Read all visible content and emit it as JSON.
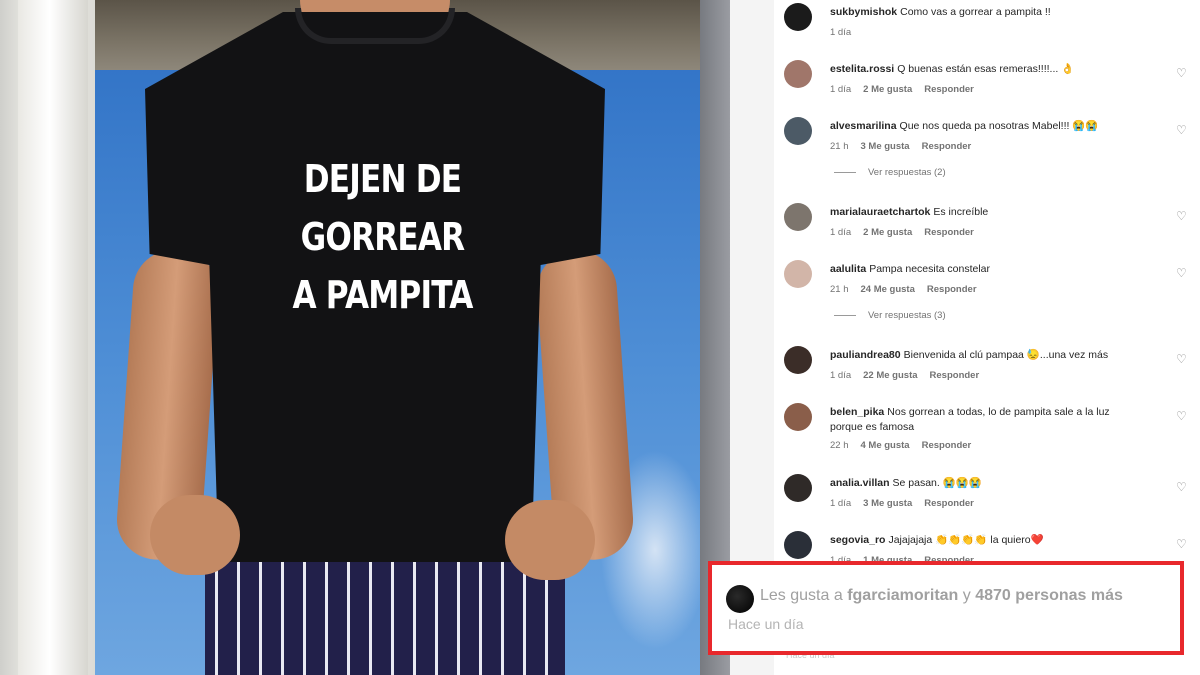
{
  "photo": {
    "shirt_lines": [
      "DEJEN DE",
      "GORREAR",
      "A PAMPITA"
    ]
  },
  "comments": [
    {
      "user": "sukbymishok",
      "text": "Como vas a gorrear a pampita !!",
      "time": "1 día",
      "likes": "",
      "reply": "",
      "avatar_color": "#1b1b1b",
      "heart": false
    },
    {
      "user": "estelita.rossi",
      "text": "Q buenas están esas remeras!!!!... 👌",
      "time": "1 día",
      "likes": "2 Me gusta",
      "reply": "Responder",
      "avatar_color": "#a0766a",
      "heart": true
    },
    {
      "user": "alvesmarilina",
      "text": "Que nos queda pa nosotras Mabel!!! 😭😭",
      "time": "21 h",
      "likes": "3 Me gusta",
      "reply": "Responder",
      "avatar_color": "#4c5a66",
      "heart": true
    },
    {
      "user": "marialauraetchartok",
      "text": "Es increíble",
      "time": "1 día",
      "likes": "2 Me gusta",
      "reply": "Responder",
      "avatar_color": "#7d756d",
      "heart": true
    },
    {
      "user": "aalulita",
      "text": "Pampa necesita constelar",
      "time": "21 h",
      "likes": "24 Me gusta",
      "reply": "Responder",
      "avatar_color": "#d2b5a8",
      "heart": true
    },
    {
      "user": "pauliandrea80",
      "text": "Bienvenida al clú pampaa 😓...una vez más",
      "time": "1 día",
      "likes": "22 Me gusta",
      "reply": "Responder",
      "avatar_color": "#3b2d28",
      "heart": true
    },
    {
      "user": "belen_pika",
      "text": "Nos gorrean a todas, lo de pampita sale a la luz porque es famosa",
      "time": "22 h",
      "likes": "4 Me gusta",
      "reply": "Responder",
      "avatar_color": "#8a5e4a",
      "heart": true
    },
    {
      "user": "analia.villan",
      "text": "Se pasan. 😭😭😭",
      "time": "1 día",
      "likes": "3 Me gusta",
      "reply": "Responder",
      "avatar_color": "#2f2a28",
      "heart": true
    },
    {
      "user": "segovia_ro",
      "text": "Jajajajaja 👏👏👏👏 la quiero❤️",
      "time": "1 día",
      "likes": "1 Me gusta",
      "reply": "Responder",
      "avatar_color": "#2a2f38",
      "heart": true
    }
  ],
  "view_replies": [
    {
      "label": "Ver respuestas (2)"
    },
    {
      "label": "Ver respuestas (3)"
    }
  ],
  "likes_box": {
    "prefix": "Les gusta a",
    "user": "fgarciamoritan",
    "middle": "y",
    "count": "4870 personas más",
    "time": "Hace un día",
    "border_color": "#e8282c"
  },
  "footer": {
    "ghost_time": "Hace un día"
  },
  "icons": {
    "heart": "♡"
  }
}
